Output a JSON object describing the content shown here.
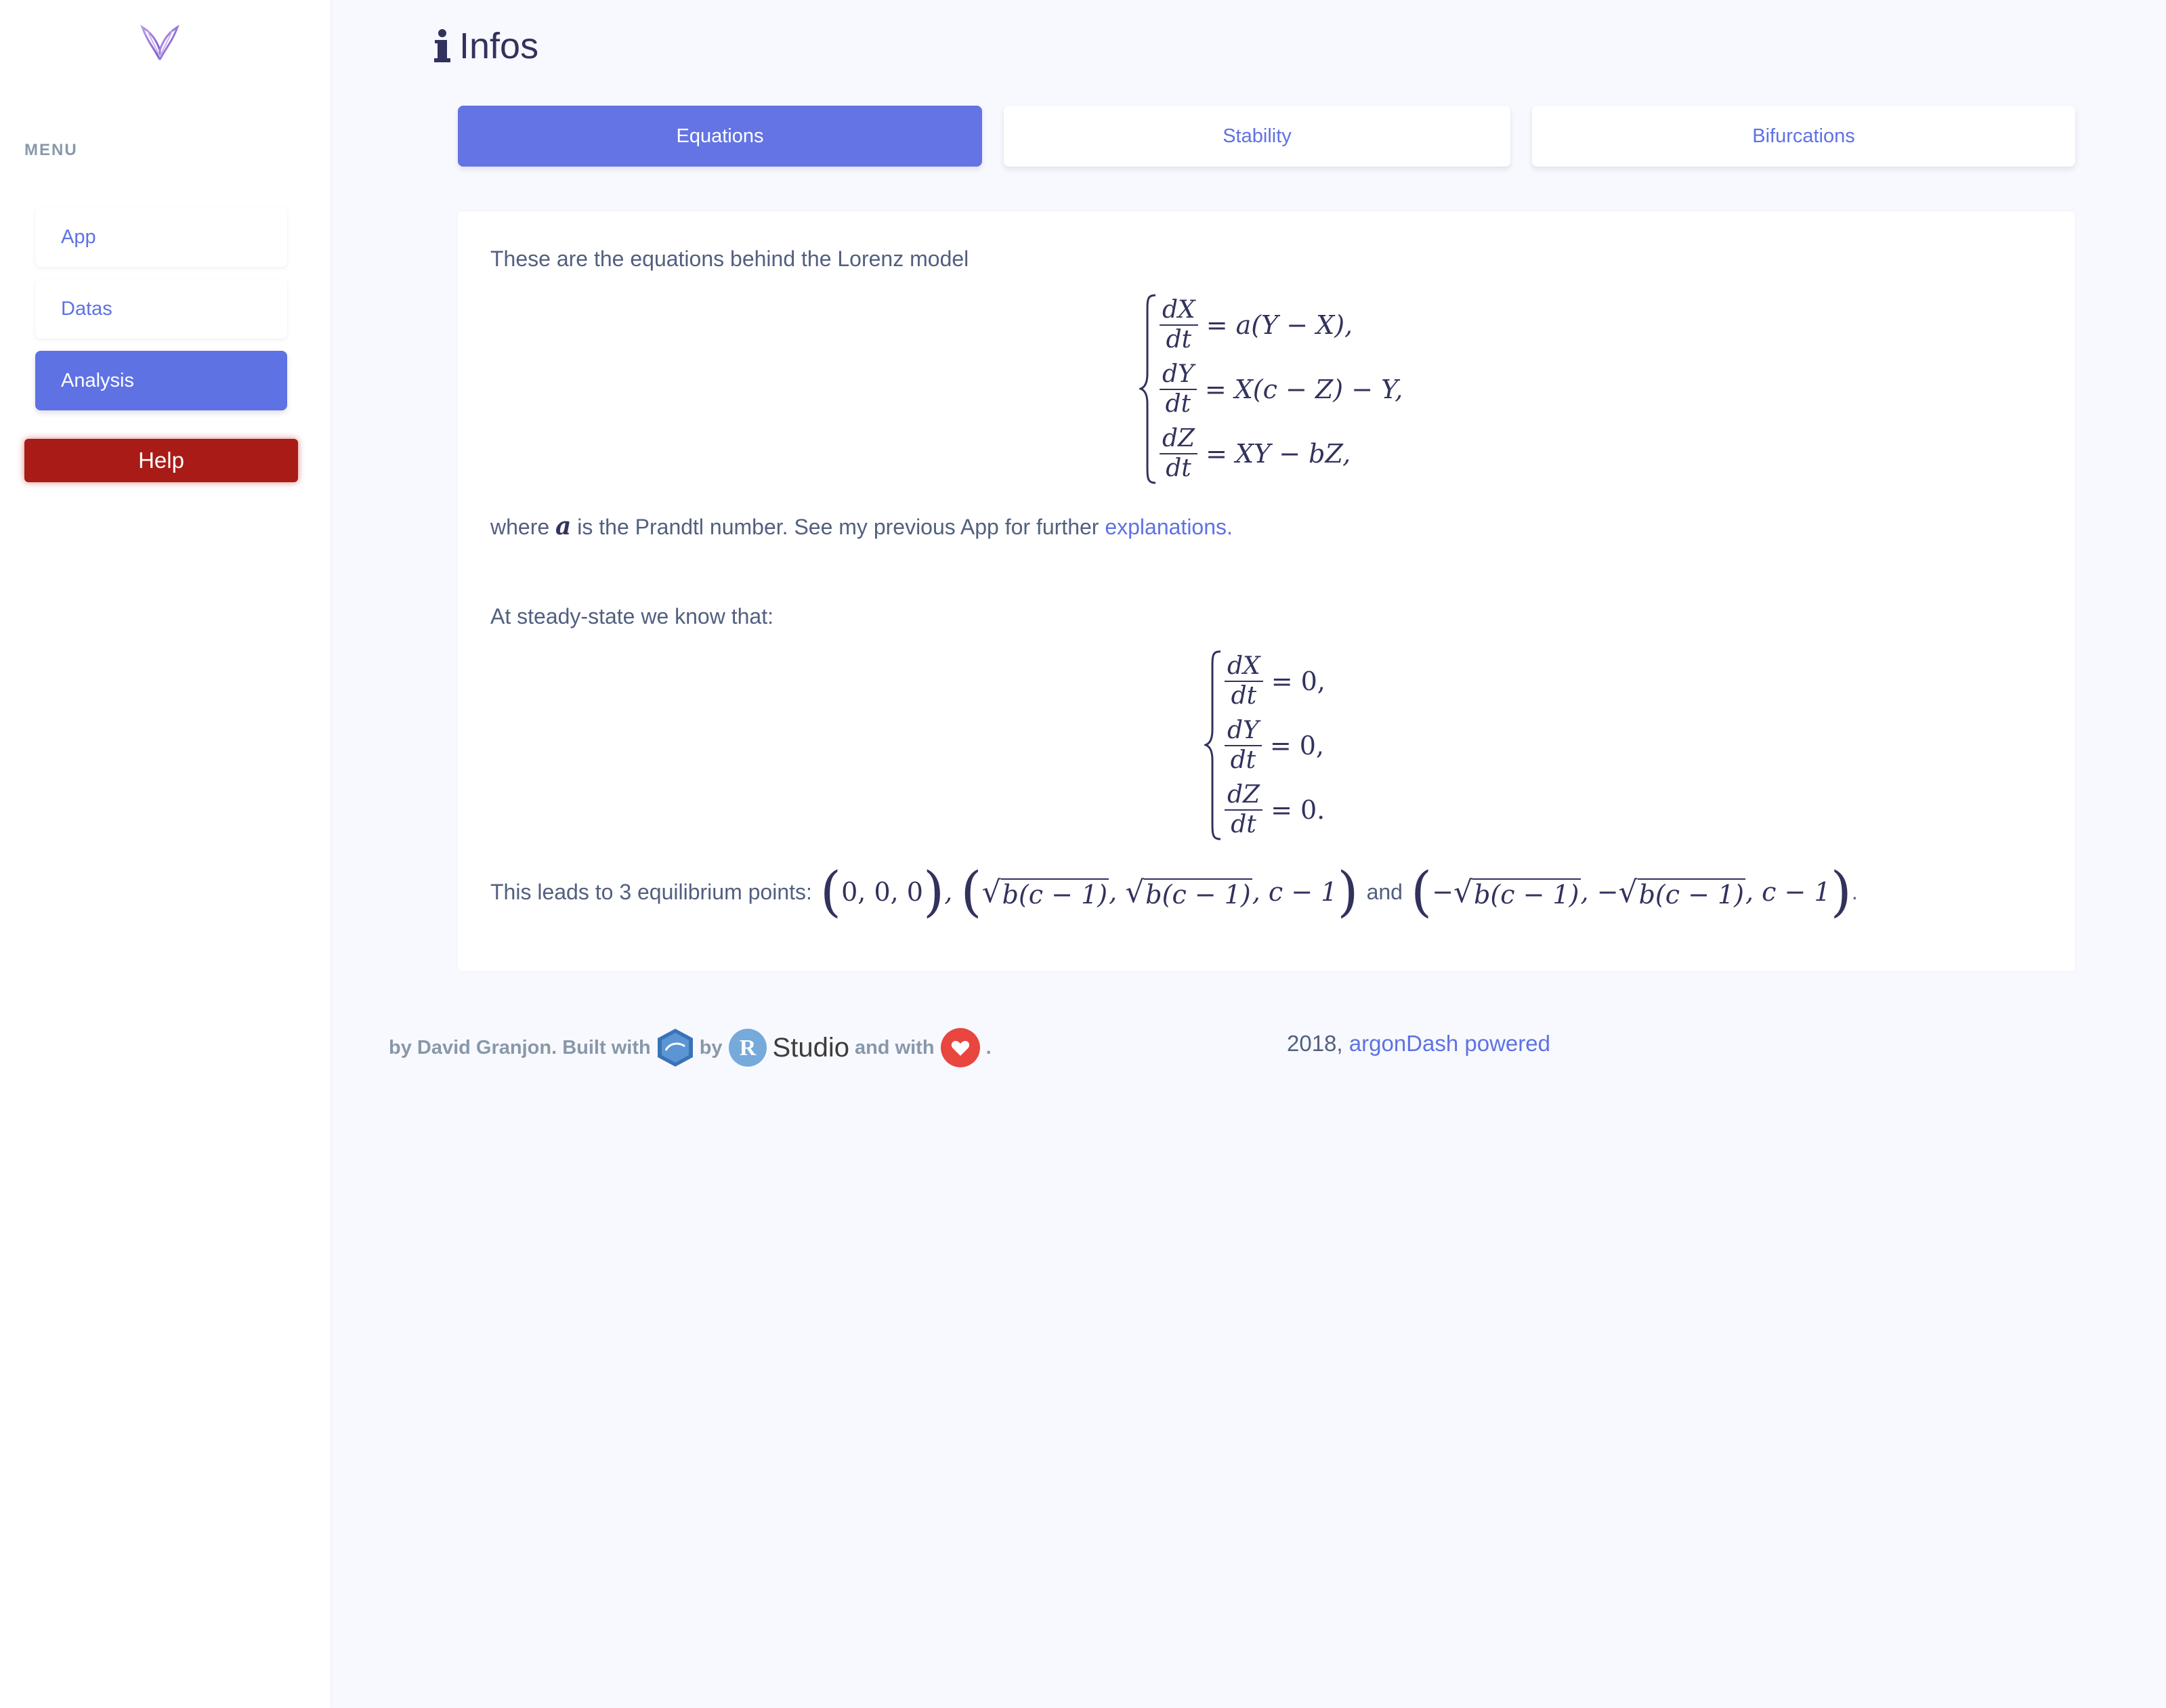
{
  "sidebar": {
    "menu_heading": "MENU",
    "items": [
      {
        "label": "App"
      },
      {
        "label": "Datas"
      },
      {
        "label": "Analysis"
      }
    ],
    "help_label": "Help"
  },
  "page": {
    "title": "Infos"
  },
  "tabs": [
    {
      "label": "Equations",
      "active": true
    },
    {
      "label": "Stability",
      "active": false
    },
    {
      "label": "Bifurcations",
      "active": false
    }
  ],
  "content": {
    "intro": "These are the equations behind the Lorenz model",
    "system1": [
      {
        "num": "dX",
        "den": "dt",
        "rhs": "= a(Y − X),"
      },
      {
        "num": "dY",
        "den": "dt",
        "rhs": "= X(c − Z) − Y,"
      },
      {
        "num": "dZ",
        "den": "dt",
        "rhs": "= XY − bZ,"
      }
    ],
    "where_prefix": "where",
    "where_var": "a",
    "where_middle": "is the Prandtl number. See my previous App for further",
    "where_link": "explanations",
    "where_suffix": ".",
    "steady": "At steady-state we know that:",
    "system2": [
      {
        "num": "dX",
        "den": "dt",
        "rhs": "= 0,"
      },
      {
        "num": "dY",
        "den": "dt",
        "rhs": "= 0,"
      },
      {
        "num": "dZ",
        "den": "dt",
        "rhs": "= 0."
      }
    ],
    "eq_prefix": "This leads to 3 equilibrium points:",
    "eq_point1": "0, 0, 0",
    "eq_sqrt": "b(c − 1)",
    "eq_tail": ", c − 1",
    "eq_and": "and",
    "eq_minus": "−"
  },
  "footer": {
    "by_text": "by David Granjon. Built with",
    "by_word": "by",
    "studio": "Studio",
    "and_with": "and with",
    "period": ".",
    "year": "2018,",
    "powered_link": "argonDash powered"
  },
  "colors": {
    "primary": "#5e72e4",
    "help": "#a91b16",
    "background": "#f8f9fe"
  }
}
